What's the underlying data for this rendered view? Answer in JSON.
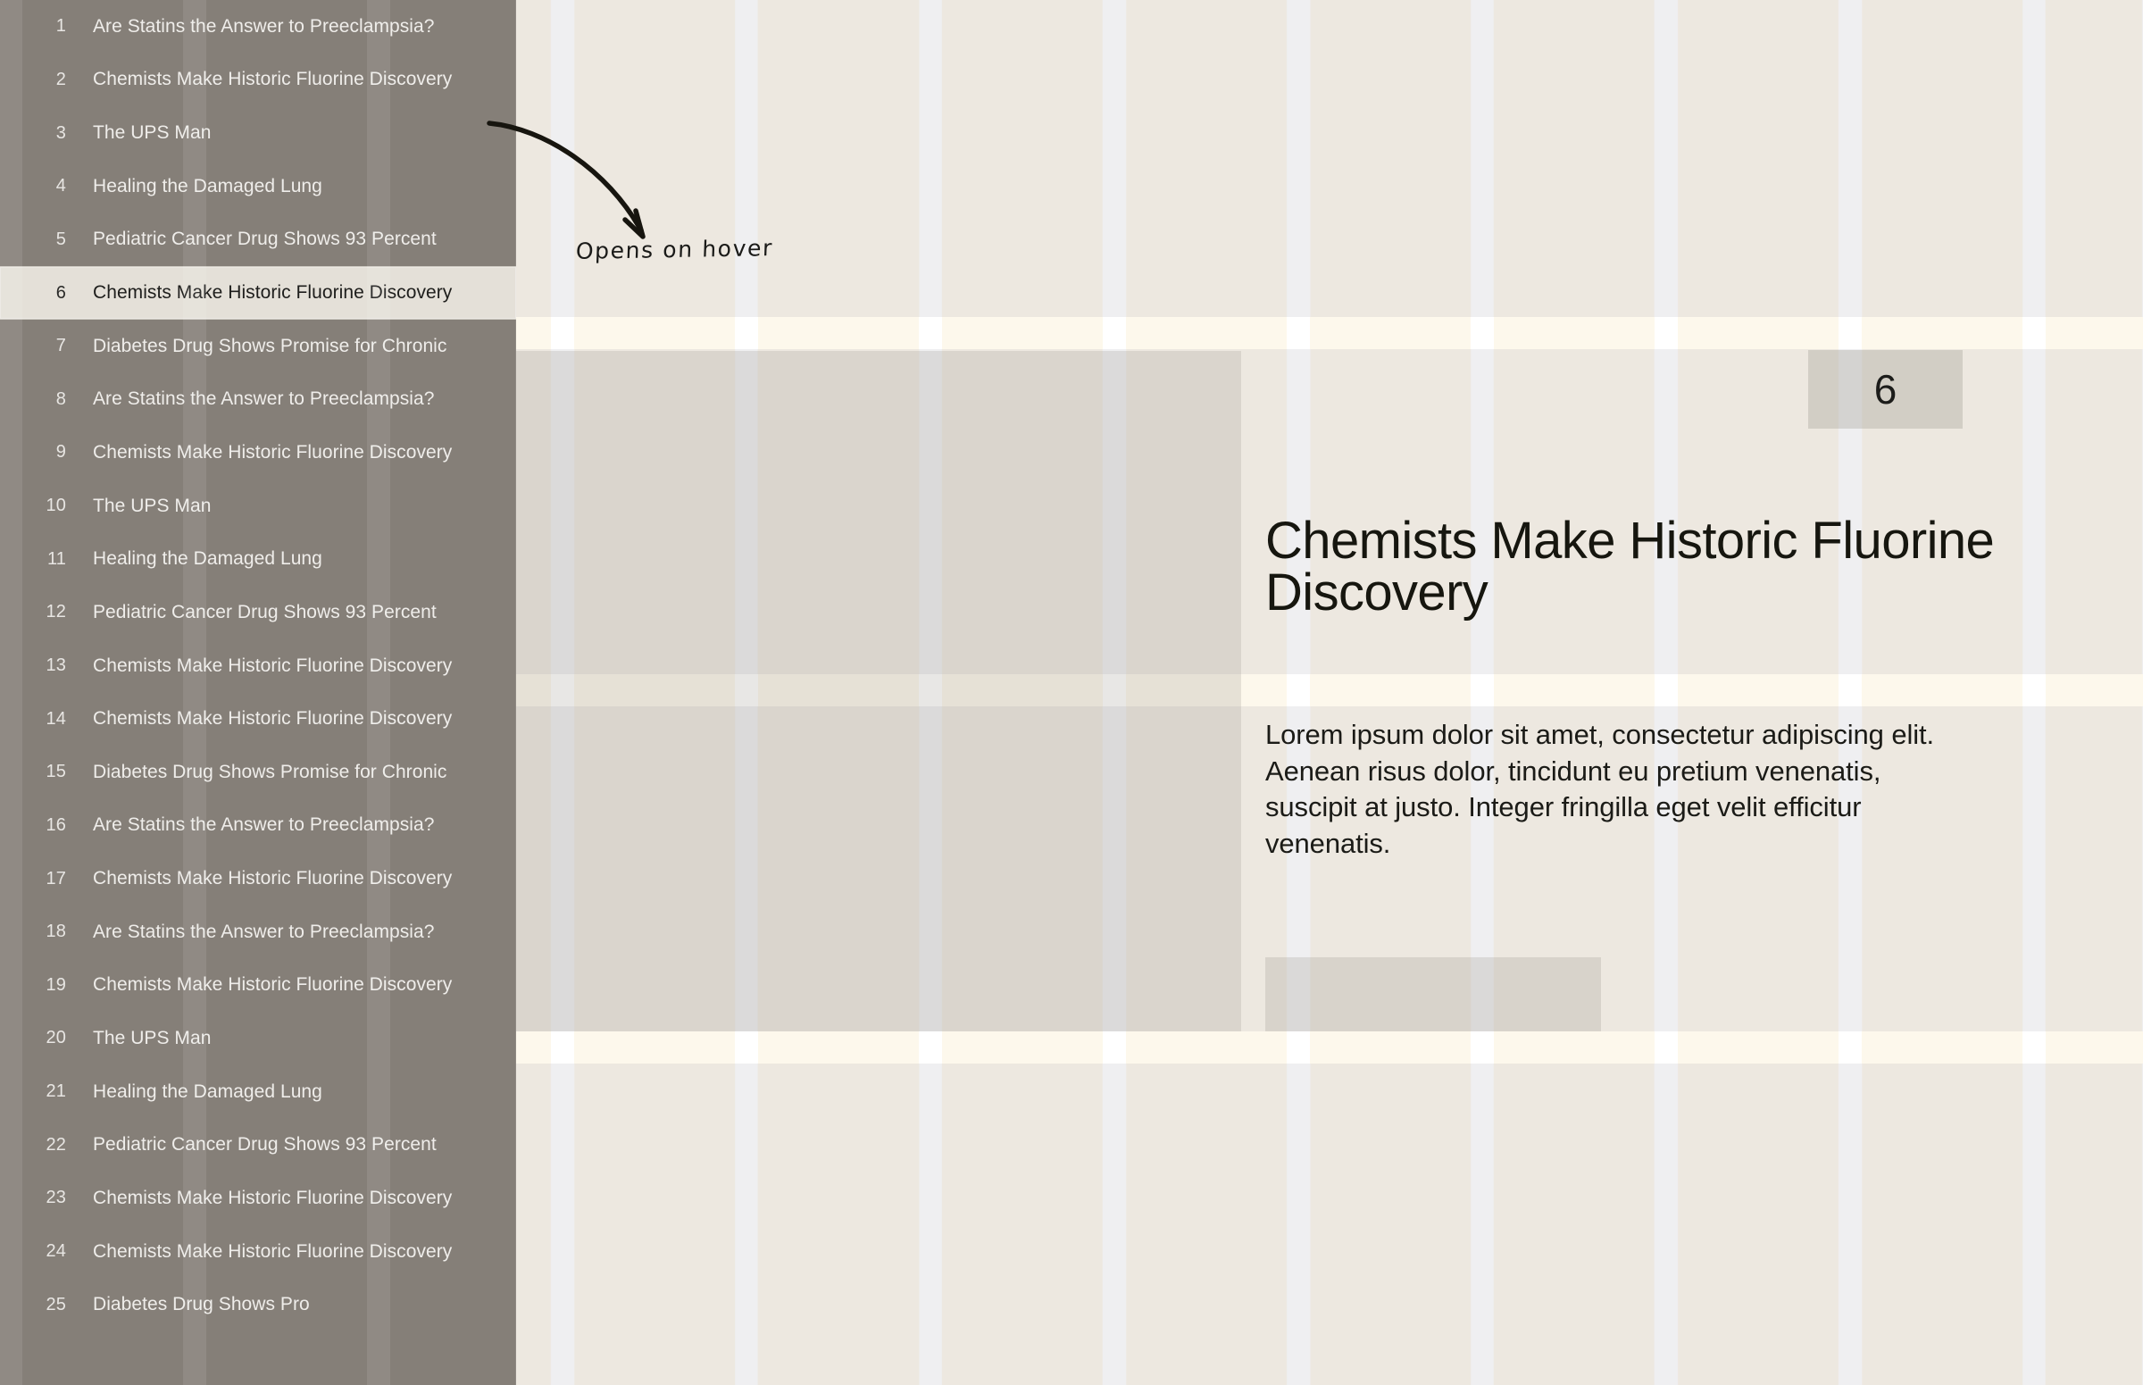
{
  "colors": {
    "sidebar_bg": "#857F78",
    "sidebar_text": "#EFEDEA",
    "selected_row_bg": "#E4E0D8",
    "selected_row_text": "#1E1E1C",
    "page_beige": "#EDE8E0",
    "page_stripe": "#EFEFF1",
    "band_cream": "#FDF8EC",
    "gray_panel": "#CCC8C0",
    "annotation_ink": "#1A1A18"
  },
  "sidebar": {
    "name": "article-list",
    "selected_index": 6,
    "items": [
      {
        "num": "1",
        "title": "Are Statins the Answer to Preeclampsia?"
      },
      {
        "num": "2",
        "title": "Chemists Make Historic Fluorine Discovery"
      },
      {
        "num": "3",
        "title": "The UPS Man"
      },
      {
        "num": "4",
        "title": "Healing the Damaged Lung"
      },
      {
        "num": "5",
        "title": "Pediatric Cancer Drug Shows 93 Percent"
      },
      {
        "num": "6",
        "title": "Chemists Make Historic Fluorine Discovery"
      },
      {
        "num": "7",
        "title": "Diabetes Drug Shows Promise for Chronic"
      },
      {
        "num": "8",
        "title": "Are Statins the Answer to Preeclampsia?"
      },
      {
        "num": "9",
        "title": "Chemists Make Historic Fluorine Discovery"
      },
      {
        "num": "10",
        "title": "The UPS Man"
      },
      {
        "num": "11",
        "title": "Healing the Damaged Lung"
      },
      {
        "num": "12",
        "title": "Pediatric Cancer Drug Shows 93 Percent"
      },
      {
        "num": "13",
        "title": "Chemists Make Historic Fluorine Discovery"
      },
      {
        "num": "14",
        "title": "Chemists Make Historic Fluorine Discovery"
      },
      {
        "num": "15",
        "title": "Diabetes Drug Shows Promise for Chronic"
      },
      {
        "num": "16",
        "title": "Are Statins the Answer to Preeclampsia?"
      },
      {
        "num": "17",
        "title": "Chemists Make Historic Fluorine Discovery"
      },
      {
        "num": "18",
        "title": "Are Statins the Answer to Preeclampsia?"
      },
      {
        "num": "19",
        "title": "Chemists Make Historic Fluorine Discovery"
      },
      {
        "num": "20",
        "title": "The UPS Man"
      },
      {
        "num": "21",
        "title": "Healing the Damaged Lung"
      },
      {
        "num": "22",
        "title": "Pediatric Cancer Drug Shows 93 Percent"
      },
      {
        "num": "23",
        "title": "Chemists Make Historic Fluorine Discovery"
      },
      {
        "num": "24",
        "title": "Chemists Make Historic Fluorine Discovery"
      },
      {
        "num": "25",
        "title": "Diabetes Drug Shows Pro"
      }
    ]
  },
  "article": {
    "badge": "6",
    "headline": "Chemists Make Historic Fluorine Discovery",
    "body": "Lorem ipsum dolor sit amet, consectetur adipiscing elit. Aenean risus dolor, tincidunt eu pretium venenatis, suscipit at justo. Integer fringilla eget velit efficitur venenatis."
  },
  "annotation": {
    "label": "Opens on hover",
    "arrow": "curved-arrow-icon"
  }
}
